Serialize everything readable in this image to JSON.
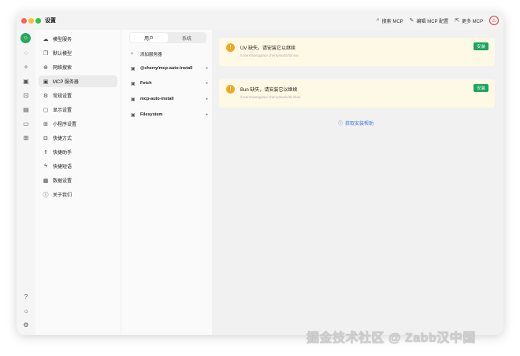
{
  "window": {
    "title": "设置"
  },
  "header_actions": [
    {
      "icon": "search-icon",
      "label": "搜索 MCP"
    },
    {
      "icon": "edit-icon",
      "label": "编辑 MCP 配置"
    },
    {
      "icon": "external-link-icon",
      "label": "更多 MCP"
    }
  ],
  "nav": {
    "items": [
      {
        "label": "模型服务",
        "icon": "cloud-icon"
      },
      {
        "label": "默认模型",
        "icon": "cube-icon"
      },
      {
        "label": "网络搜索",
        "icon": "globe-icon"
      },
      {
        "label": "MCP 服务器",
        "icon": "terminal-icon",
        "active": true
      },
      {
        "label": "常规设置",
        "icon": "gear-icon"
      },
      {
        "label": "显示设置",
        "icon": "monitor-icon"
      },
      {
        "label": "小程序设置",
        "icon": "grid-icon"
      },
      {
        "label": "快捷方式",
        "icon": "shortcut-icon"
      },
      {
        "label": "快捷助手",
        "icon": "rocket-icon"
      },
      {
        "label": "快捷短语",
        "icon": "zap-icon"
      },
      {
        "label": "数据设置",
        "icon": "database-icon"
      },
      {
        "label": "关于我们",
        "icon": "info-icon"
      }
    ]
  },
  "servers": {
    "tabs": [
      "用户",
      "系统"
    ],
    "add_label": "添加服务器",
    "items": [
      {
        "name": "@cherry/mcp-auto-install"
      },
      {
        "name": "Fetch"
      },
      {
        "name": "mcp-auto-install"
      },
      {
        "name": "Filesystem"
      }
    ]
  },
  "main": {
    "cards": [
      {
        "title": "UV 缺失，请安装它以继续",
        "path": "/Users/wangqiao/.cherrystudio/bin/uv",
        "button": "安装"
      },
      {
        "title": "Bun 缺失，请安装它以继续",
        "path": "/Users/wangqiao/.cherrystudio/bin/bun",
        "button": "安装"
      }
    ],
    "help_link": "获取安装帮助"
  },
  "watermark": "掘金技术社区 @ Zabb汉中国",
  "colors": {
    "accent_green": "#1aa35b",
    "warning": "#f5a623",
    "link": "#3a7bd5",
    "alert_red": "#e53935"
  }
}
